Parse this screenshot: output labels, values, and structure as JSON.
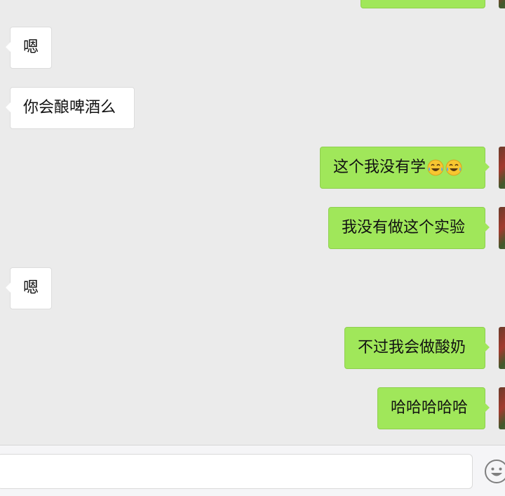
{
  "messages": [
    {
      "dir": "in",
      "text": "嗯"
    },
    {
      "dir": "in",
      "text": "你会酿啤酒么"
    },
    {
      "dir": "out",
      "text": "这个我没有学",
      "emojis": [
        "tears-of-joy-emoji",
        "tears-of-joy-emoji"
      ]
    },
    {
      "dir": "out",
      "text": "我没有做这个实验"
    },
    {
      "dir": "in",
      "text": "嗯"
    },
    {
      "dir": "out",
      "text": "不过我会做酸奶"
    },
    {
      "dir": "out",
      "text": "哈哈哈哈哈"
    }
  ],
  "input": {
    "value": "",
    "placeholder": ""
  },
  "icons": {
    "emoji_button": "smiley-icon"
  },
  "colors": {
    "background": "#ebebeb",
    "outgoing_bubble": "#a0e75a",
    "incoming_bubble": "#ffffff"
  }
}
